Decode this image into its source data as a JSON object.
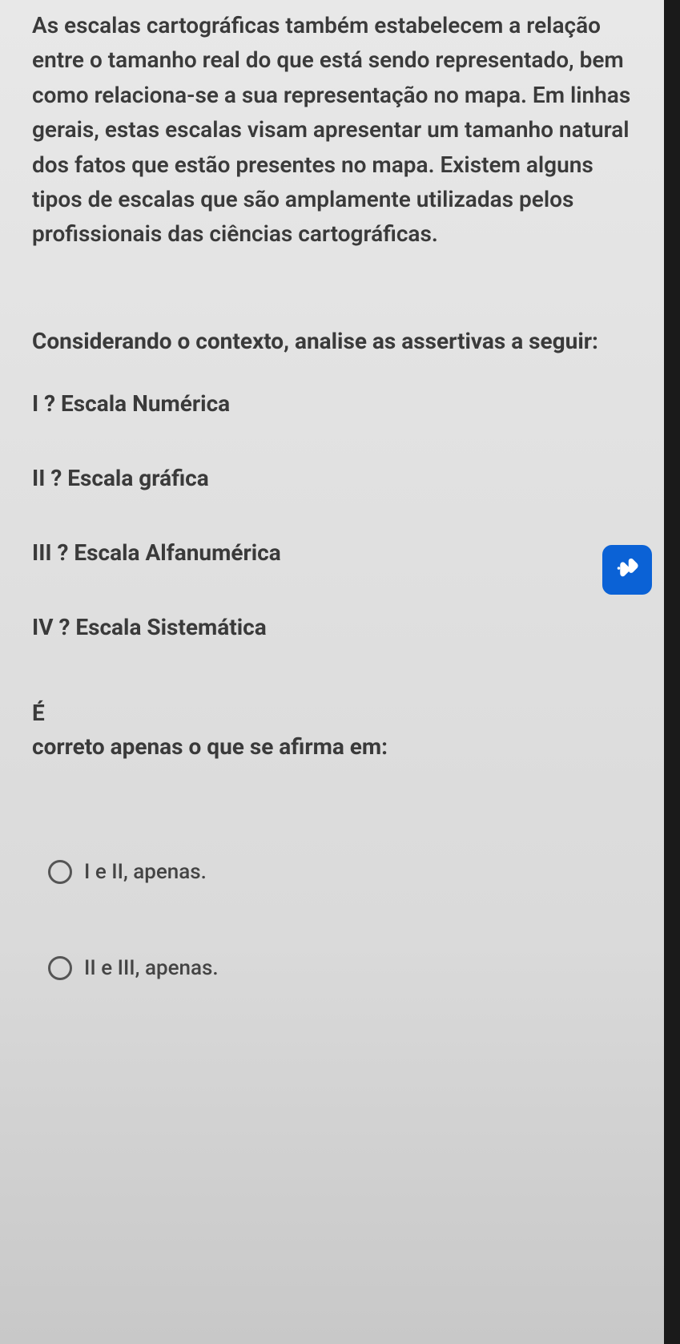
{
  "question": {
    "intro_paragraph": "As escalas cartográficas também estabelecem a relação entre o tamanho real do que está sendo representado, bem como relaciona-se a sua representação no mapa. Em linhas gerais, estas escalas visam apresentar um tamanho natural dos fatos que estão presentes no mapa. Existem alguns tipos de escalas que são amplamente utilizadas pelos profissionais das ciências cartográficas.",
    "instruction": "Considerando o contexto, analise as assertivas a seguir:",
    "assertions": {
      "a1": "I ? Escala Numérica",
      "a2": "II ? Escala gráfica",
      "a3": "III ? Escala Alfanumérica",
      "a4": "IV ? Escala Sistemática"
    },
    "answer_prompt_line1": "É",
    "answer_prompt_line2": "correto apenas o que se afirma em:",
    "options": {
      "opt1": "I e II, apenas.",
      "opt2": "II e III, apenas."
    }
  },
  "accessibility_button": {
    "name": "libras-accessibility"
  }
}
